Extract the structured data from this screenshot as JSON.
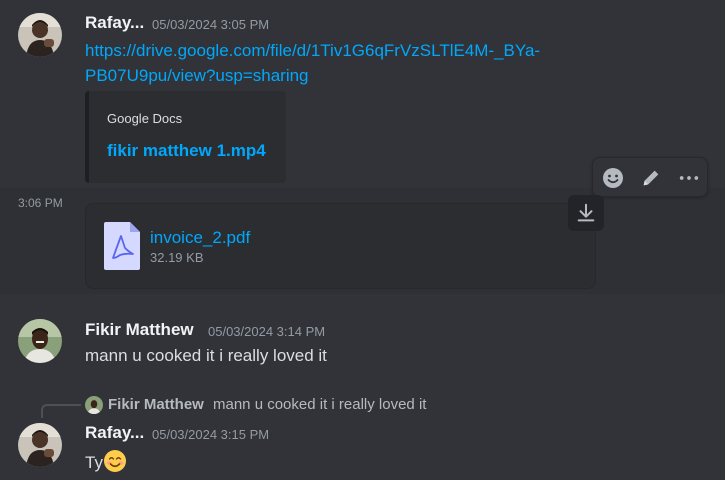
{
  "messages": {
    "first": {
      "username": "Rafay...",
      "timestamp": "05/03/2024 3:05 PM",
      "link_line1": "https://drive.google.com/file/d/1Tiv1G6qFrVzSLTlE4M-_BYa-",
      "link_line2": "PB07U9pu/view?usp=sharing",
      "embed": {
        "provider": "Google Docs",
        "title": "fikir matthew 1.mp4"
      }
    },
    "attachment_msg": {
      "timestamp": "3:06 PM",
      "file_name": "invoice_2.pdf",
      "file_size": "32.19 KB"
    },
    "second": {
      "username": "Fikir Matthew",
      "timestamp": "05/03/2024 3:14 PM",
      "text": "mann u cooked it i really loved it"
    },
    "third": {
      "reply": {
        "username": "Fikir Matthew",
        "text": "mann u cooked it i really loved it"
      },
      "username": "Rafay...",
      "timestamp": "05/03/2024 3:15 PM",
      "text": "Ty"
    }
  },
  "toolbar": {
    "icons": [
      "add-reaction-icon",
      "edit-icon",
      "more-options-icon"
    ]
  },
  "colors": {
    "background": "#313338",
    "link": "#00a8fc",
    "muted": "#949ba4",
    "embed_bg": "#2b2d31"
  }
}
